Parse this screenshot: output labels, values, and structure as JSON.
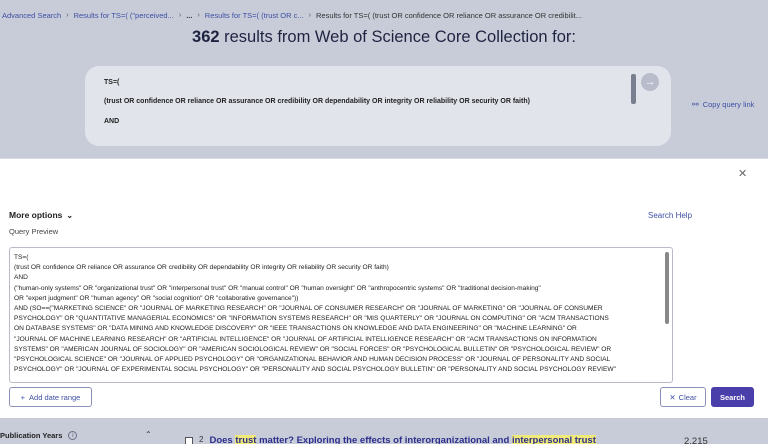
{
  "breadcrumb": {
    "items": [
      "Advanced Search",
      "Results for TS=( (\"perceived...",
      "...",
      "Results for TS=( (trust OR c...",
      "Results for TS=( (trust OR confidence OR reliance OR assurance OR credibilit..."
    ]
  },
  "header": {
    "count": "362",
    "title_rest": "results from Web of Science Core Collection for:"
  },
  "query_box": {
    "line1": "TS=(",
    "line2": "(trust OR confidence OR reliance OR assurance OR credibility OR dependability OR integrity OR reliability OR security OR faith)",
    "line3": "AND"
  },
  "copy_link": {
    "label": "Copy query link",
    "icon": "link-icon"
  },
  "panel": {
    "more_options": "More options",
    "search_help": "Search Help",
    "query_preview_label": "Query Preview",
    "preview_lines": [
      "TS=(",
      "(trust OR confidence OR reliance OR assurance OR credibility OR dependability OR integrity OR reliability OR security OR faith)",
      "AND",
      "(\"human-only systems\" OR \"organizational trust\" OR \"interpersonal trust\" OR \"manual control\" OR \"human oversight\" OR \"anthropocentric systems\" OR \"traditional decision-making\"",
      "OR \"expert judgment\" OR \"human agency\" OR \"social cognition\" OR \"collaborative governance\"))",
      "AND (SO==(\"MARKETING SCIENCE\" OR \"JOURNAL OF MARKETING RESEARCH\" OR \"JOURNAL OF CONSUMER RESEARCH\" OR \"JOURNAL OF MARKETING\" OR \"JOURNAL OF CONSUMER",
      "PSYCHOLOGY\" OR \"QUANTITATIVE MANAGERIAL ECONOMICS\" OR \"INFORMATION SYSTEMS RESEARCH\" OR \"MIS QUARTERLY\" OR \"JOURNAL ON COMPUTING\" OR \"ACM TRANSACTIONS",
      "ON DATABASE SYSTEMS\" OR \"DATA MINING AND KNOWLEDGE DISCOVERY\" OR \"IEEE TRANSACTIONS ON KNOWLEDGE AND DATA ENGINEERING\" OR \"MACHINE LEARNING\" OR",
      "\"JOURNAL OF MACHINE LEARNING RESEARCH\" OR \"ARTIFICIAL INTELLIGENCE\" OR \"JOURNAL OF ARTIFICIAL INTELLIGENCE RESEARCH\" OR \"ACM TRANSACTIONS ON INFORMATION",
      "SYSTEMS\" OR \"AMERICAN JOURNAL OF SOCIOLOGY\" OR \"AMERICAN SOCIOLOGICAL REVIEW\" OR \"SOCIAL FORCES\" OR \"PSYCHOLOGICAL BULLETIN\" OR \"PSYCHOLOGICAL REVIEW\" OR",
      "\"PSYCHOLOGICAL SCIENCE\" OR \"JOURNAL OF APPLIED PSYCHOLOGY\" OR \"ORGANIZATIONAL BEHAVIOR AND HUMAN DECISION PROCESS\" OR \"JOURNAL OF PERSONALITY AND SOCIAL",
      "PSYCHOLOGY\" OR \"JOURNAL OF EXPERIMENTAL SOCIAL PSYCHOLOGY\" OR \"PERSONALITY AND SOCIAL PSYCHOLOGY BULLETIN\" OR \"PERSONALITY AND SOCIAL PSYCHOLOGY REVIEW\""
    ],
    "add_date_range": "Add date range",
    "clear": "Clear",
    "search": "Search"
  },
  "bottom": {
    "pub_years": "Publication Years",
    "result_number": "2",
    "result_title_pre": "Does ",
    "result_title_hl1": "trust",
    "result_title_mid": " matter? Exploring the effects of interorganizational and ",
    "result_title_hl2": "interpersonal trust",
    "result_count": "2,215"
  },
  "colors": {
    "accent": "#3e4fa3",
    "search_button": "#4a3eaa",
    "overlay": "#c8ccd9",
    "highlight": "#f1ea7a"
  }
}
